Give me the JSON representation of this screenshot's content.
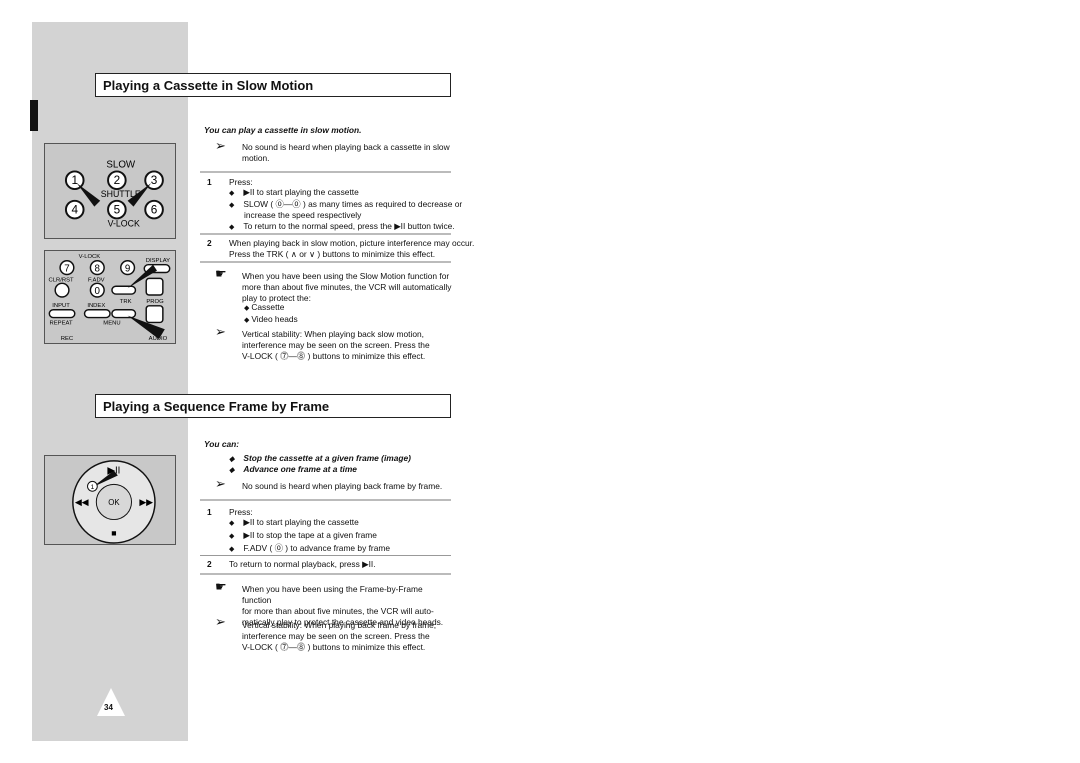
{
  "page_number": "34",
  "section1": {
    "title": "Playing a Cassette in Slow Motion",
    "intro": "You can play a cassette in slow motion.",
    "note1": [
      "No sound is heard when playing back a cassette in slow",
      "motion."
    ],
    "step1": {
      "num": "1",
      "label": "Press:",
      "bullets": [
        "▶II to start playing the cassette",
        "SLOW ( ⓪—⓪ ) as many times as required to decrease or",
        "To return to the normal speed, press the ▶II button twice."
      ],
      "cont": "increase the speed respectively"
    },
    "step2": {
      "num": "2",
      "lines": [
        "When playing back in slow motion, picture interference may occur.",
        "Press the TRK ( ∧ or ∨ ) buttons to minimize this effect."
      ]
    },
    "warn": [
      "When you have been using the Slow Motion function for",
      "more than about five minutes, the VCR will automatically",
      "play to protect the:"
    ],
    "protect": [
      "Cassette",
      "Video heads"
    ],
    "note2": [
      "Vertical stability: When playing back slow motion,",
      "interference may be seen on the screen. Press the",
      "V-LOCK ( ⓻—⓼ ) buttons to minimize this effect."
    ]
  },
  "section2": {
    "title": "Playing a Sequence Frame by Frame",
    "intro": "You can:",
    "can": [
      "Stop the cassette at a given frame (image)",
      "Advance one frame at a time"
    ],
    "note1": "No sound is heard when playing back frame by frame.",
    "step1": {
      "num": "1",
      "label": "Press:",
      "bullets": [
        "▶II to start playing the cassette",
        "▶II to stop the tape at a given frame",
        "F.ADV ( ⓪ ) to advance frame by frame"
      ]
    },
    "step2": {
      "num": "2",
      "text": "To return to normal playback, press ▶II."
    },
    "warn": [
      "When you have been using the Frame-by-Frame function",
      "for more than about five minutes, the VCR will auto-",
      "matically play to protect the cassette and video heads."
    ],
    "note2": [
      "Vertical stability: When playing back frame by frame,",
      "interference may be seen on the screen. Press the",
      "V-LOCK ( ⓻—⓼ ) buttons to minimize this effect."
    ]
  },
  "remote1": {
    "slow": "SLOW",
    "shuttle": "SHUTTLE",
    "vlock": "V-LOCK",
    "keys": [
      "1",
      "2",
      "3",
      "4",
      "5",
      "6"
    ]
  },
  "remote2": {
    "vlock": "V-LOCK",
    "display": "DISPLAY",
    "clrrst": "CLR/RST",
    "fadv": "F.ADV",
    "trk": "TRK",
    "prog": "PROG",
    "input": "INPUT",
    "index": "INDEX",
    "repeat": "REPEAT",
    "menu": "MENU",
    "rec": "REC",
    "audio": "AUDIO",
    "keys": [
      "7",
      "8",
      "9",
      "0"
    ]
  },
  "remote3": {
    "ok": "OK",
    "callout": "1"
  }
}
